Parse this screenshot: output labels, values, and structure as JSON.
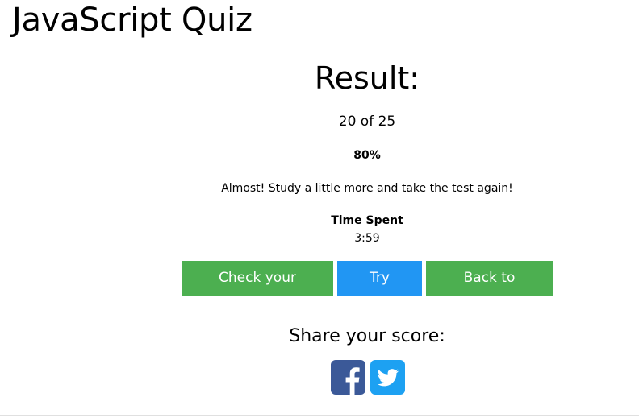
{
  "page": {
    "title": "JavaScript Quiz"
  },
  "result": {
    "heading": "Result:",
    "score_text": "20 of 25",
    "correct": 20,
    "total": 25,
    "percent_text": "80%",
    "message": "Almost! Study a little more and take the test again!",
    "time_label": "Time Spent",
    "time_value": "3:59"
  },
  "buttons": {
    "check_label": "Check your answers",
    "try_again_label": "Try Again",
    "back_label": "Back to Quizzes"
  },
  "share": {
    "heading": "Share your score:",
    "facebook_icon": "facebook-icon",
    "twitter_icon": "twitter-icon"
  },
  "colors": {
    "green": "#4caf50",
    "blue": "#2196f3",
    "facebook": "#3b5998",
    "twitter": "#1da1f2"
  }
}
